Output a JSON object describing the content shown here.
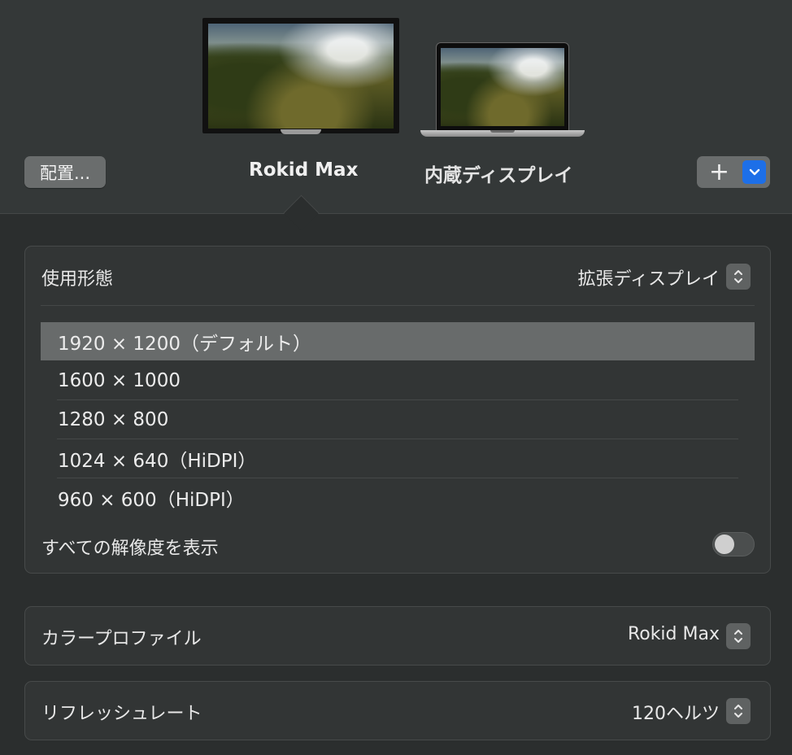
{
  "header": {
    "arrange_button": "配置...",
    "displays": [
      {
        "name": "Rokid Max",
        "selected": true
      },
      {
        "name": "内蔵ディスプレイ",
        "selected": false
      }
    ],
    "add_button": "+"
  },
  "usage": {
    "label": "使用形態",
    "value": "拡張ディスプレイ"
  },
  "resolutions": {
    "items": [
      {
        "label": "1920 × 1200（デフォルト）",
        "selected": true
      },
      {
        "label": "1600 × 1000",
        "selected": false
      },
      {
        "label": "1280 × 800",
        "selected": false
      },
      {
        "label": "1024 × 640（HiDPI）",
        "selected": false
      },
      {
        "label": "960 × 600（HiDPI）",
        "selected": false
      }
    ],
    "show_all_label": "すべての解像度を表示",
    "show_all_enabled": false
  },
  "color_profile": {
    "label": "カラープロファイル",
    "value": "Rokid Max"
  },
  "refresh_rate": {
    "label": "リフレッシュレート",
    "value": "120ヘルツ"
  },
  "colors": {
    "accent": "#1d6fe8",
    "background": "#2b2e2e",
    "selected_row": "#686b6b"
  }
}
